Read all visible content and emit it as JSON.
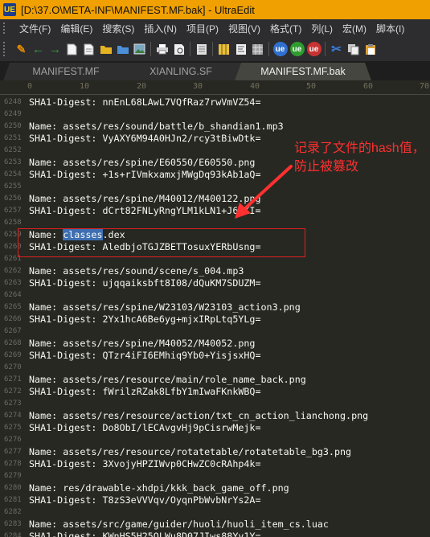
{
  "window": {
    "title": "[D:\\37.O\\META-INF\\MANIFEST.MF.bak] - UltraEdit",
    "app_icon_text": "UE"
  },
  "menu": [
    "文件(F)",
    "编辑(E)",
    "搜索(S)",
    "插入(N)",
    "项目(P)",
    "视图(V)",
    "格式(T)",
    "列(L)",
    "宏(M)",
    "脚本(I)"
  ],
  "toolbar": {
    "buttons": [
      {
        "icon": "edit-icon",
        "glyph": "✎",
        "color": "#e08a00"
      },
      {
        "icon": "back-arrow-icon",
        "glyph": "←",
        "color": "#3aa33a"
      },
      {
        "icon": "forward-arrow-icon",
        "glyph": "→",
        "color": "#3aa33a"
      },
      {
        "icon": "new-file-icon",
        "glyph": "",
        "color": "#f4f4f4"
      },
      {
        "icon": "new-file-2-icon",
        "glyph": "",
        "color": "#f4f4f4"
      },
      {
        "icon": "open-folder-icon",
        "glyph": "",
        "color": "#e6b422"
      },
      {
        "icon": "open-folder-2-icon",
        "glyph": "",
        "color": "#4a8fd8"
      },
      {
        "icon": "image-icon",
        "glyph": "",
        "color": "#7aa6c2"
      },
      {
        "icon": "print-icon",
        "glyph": "",
        "color": "#d0d0d0"
      },
      {
        "icon": "print-preview-icon",
        "glyph": "",
        "color": "#c0c0c0"
      },
      {
        "icon": "document-list-icon",
        "glyph": "",
        "color": "#e0e0e0"
      },
      {
        "icon": "column-icon",
        "glyph": "",
        "color": "#e8c040"
      },
      {
        "icon": "text-view-icon",
        "glyph": "",
        "color": "#f0f0f0"
      },
      {
        "icon": "grid-view-icon",
        "glyph": "",
        "color": "#a0a0a0"
      },
      {
        "icon": "ue-blue-icon",
        "glyph": "ue",
        "color": "#2f6fce"
      },
      {
        "icon": "ue-green-icon",
        "glyph": "ue",
        "color": "#2e9b2e"
      },
      {
        "icon": "ue-red-icon",
        "glyph": "ue",
        "color": "#c83232"
      },
      {
        "icon": "cut-icon",
        "glyph": "✂",
        "color": "#3b7dd8"
      },
      {
        "icon": "copy-icon",
        "glyph": "",
        "color": "#f0f0f0"
      },
      {
        "icon": "paste-icon",
        "glyph": "",
        "color": "#e0a030"
      }
    ]
  },
  "tabs": [
    {
      "label": "MANIFEST.MF",
      "active": false
    },
    {
      "label": "XIANLING.SF",
      "active": false
    },
    {
      "label": "MANIFEST.MF.bak",
      "active": true
    }
  ],
  "ruler": {
    "labels": [
      "0",
      "10",
      "20",
      "30",
      "40",
      "50",
      "60",
      "70"
    ]
  },
  "lines": [
    {
      "n": "6248",
      "t": "SHA1-Digest: nnEnL68LAwL7VQfRaz7rwVmVZ54="
    },
    {
      "n": "6249",
      "t": ""
    },
    {
      "n": "6250",
      "t": "Name: assets/res/sound/battle/b_shandian1.mp3"
    },
    {
      "n": "6251",
      "t": "SHA1-Digest: VyAXY6M94A0HJn2/rcy3tBiwDtk="
    },
    {
      "n": "6252",
      "t": ""
    },
    {
      "n": "6253",
      "t": "Name: assets/res/spine/E60550/E60550.png"
    },
    {
      "n": "6254",
      "t": "SHA1-Digest: +1s+rIVmkxamxjMWgDq93kAb1aQ="
    },
    {
      "n": "6255",
      "t": ""
    },
    {
      "n": "6256",
      "t": "Name: assets/res/spine/M40012/M400122.png"
    },
    {
      "n": "6257",
      "t": "SHA1-Digest: dCrt82FNLyRngYLM1kLN1+J6DKI="
    },
    {
      "n": "6258",
      "t": ""
    },
    {
      "n": "6259",
      "t": "Name: classes.dex",
      "pre": "Name: ",
      "sel": "classes",
      "post": ".dex"
    },
    {
      "n": "6260",
      "t": "SHA1-Digest: AledbjoTGJZBETTosuxYERbUsng="
    },
    {
      "n": "6261",
      "t": ""
    },
    {
      "n": "6262",
      "t": "Name: assets/res/sound/scene/s_004.mp3"
    },
    {
      "n": "6263",
      "t": "SHA1-Digest: ujqqaiksbft8I08/dQuKM7SDUZM="
    },
    {
      "n": "6264",
      "t": ""
    },
    {
      "n": "6265",
      "t": "Name: assets/res/spine/W23103/W23103_action3.png"
    },
    {
      "n": "6266",
      "t": "SHA1-Digest: 2Yx1hcA6Be6yg+mjxIRpLtq5YLg="
    },
    {
      "n": "6267",
      "t": ""
    },
    {
      "n": "6268",
      "t": "Name: assets/res/spine/M40052/M40052.png"
    },
    {
      "n": "6269",
      "t": "SHA1-Digest: QTzr4iFI6EMhiq9Yb0+YisjsxHQ="
    },
    {
      "n": "6270",
      "t": ""
    },
    {
      "n": "6271",
      "t": "Name: assets/res/resource/main/role_name_back.png"
    },
    {
      "n": "6272",
      "t": "SHA1-Digest: fWrilzRZak8LfbY1mIwaFKnkWBQ="
    },
    {
      "n": "6273",
      "t": ""
    },
    {
      "n": "6274",
      "t": "Name: assets/res/resource/action/txt_cn_action_lianchong.png"
    },
    {
      "n": "6275",
      "t": "SHA1-Digest: Do8ObI/lECAvgvHj9pCisrwMejk="
    },
    {
      "n": "6276",
      "t": ""
    },
    {
      "n": "6277",
      "t": "Name: assets/res/resource/rotatetable/rotatetable_bg3.png"
    },
    {
      "n": "6278",
      "t": "SHA1-Digest: 3XvojyHPZIWvp0CHwZC0cRAhp4k="
    },
    {
      "n": "6279",
      "t": ""
    },
    {
      "n": "6280",
      "t": "Name: res/drawable-xhdpi/kkk_back_game_off.png"
    },
    {
      "n": "6281",
      "t": "SHA1-Digest: T8zS3eVVVqv/OyqnPbWvbNrYs2A="
    },
    {
      "n": "6282",
      "t": ""
    },
    {
      "n": "6283",
      "t": "Name: assets/src/game/guider/huoli/huoli_item_cs.luac"
    },
    {
      "n": "6284",
      "t": "SHA1-Digest: KWnHS5H25QLWu8D07JIws88Yv1Y="
    }
  ],
  "annotation": {
    "line1": "记录了文件的hash值，",
    "line2": "防止被篡改",
    "color": "#ff3030"
  }
}
